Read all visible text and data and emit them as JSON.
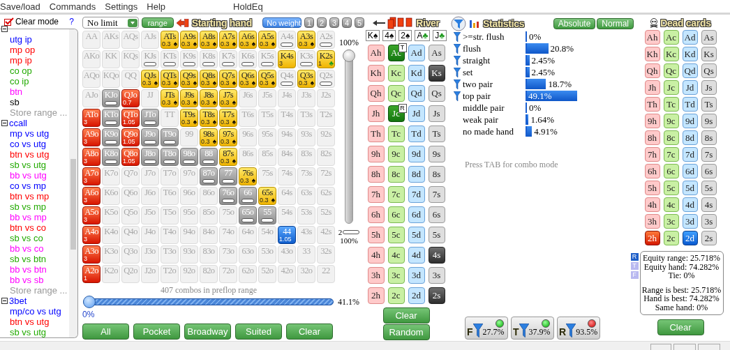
{
  "menu": [
    "Save/load",
    "Commands",
    "Settings",
    "Help"
  ],
  "title": "HoldEq",
  "sidebar": {
    "clear_mode": "Clear mode",
    "help": "?",
    "tree": [
      {
        "expanded": true,
        "children": [
          {
            "label": "utg ip",
            "color": "#0000ff"
          },
          {
            "label": "mp op",
            "color": "#ff0000"
          },
          {
            "label": "mp ip",
            "color": "#ff0000"
          },
          {
            "label": "co op",
            "color": "#22aa00"
          },
          {
            "label": "co ip",
            "color": "#22aa00"
          },
          {
            "label": "btn",
            "color": "#ff00ff"
          },
          {
            "label": "sb",
            "color": "#000000"
          },
          {
            "label": "Store range ...",
            "color": "#999999"
          }
        ]
      },
      {
        "label": "ccall",
        "color": "#0000ff",
        "expanded": true,
        "children": [
          {
            "label": "mp vs utg",
            "color": "#0000ff"
          },
          {
            "label": "co vs utg",
            "color": "#0000ff"
          },
          {
            "label": "btn vs utg",
            "color": "#ff0000"
          },
          {
            "label": "sb vs utg",
            "color": "#22aa00"
          },
          {
            "label": "bb vs utg",
            "color": "#ff00ff"
          },
          {
            "label": "co vs mp",
            "color": "#0000ff"
          },
          {
            "label": "btn vs mp",
            "color": "#ff0000"
          },
          {
            "label": "sb vs mp",
            "color": "#22aa00"
          },
          {
            "label": "bb vs mp",
            "color": "#ff00ff"
          },
          {
            "label": "btn vs co",
            "color": "#ff0000"
          },
          {
            "label": "sb vs co",
            "color": "#22aa00"
          },
          {
            "label": "bb vs co",
            "color": "#ff00ff"
          },
          {
            "label": "sb vs btn",
            "color": "#22aa00"
          },
          {
            "label": "bb vs btn",
            "color": "#ff00ff"
          },
          {
            "label": "bb vs sb",
            "color": "#ff00ff"
          },
          {
            "label": "Store range ...",
            "color": "#999999"
          }
        ]
      },
      {
        "label": "3bet",
        "color": "#0000ff",
        "expanded": true,
        "children": [
          {
            "label": "mp/co vs utg",
            "color": "#0000ff"
          },
          {
            "label": "btn vs utg",
            "color": "#ff0000"
          },
          {
            "label": "sb vs utg",
            "color": "#22aa00"
          }
        ]
      }
    ]
  },
  "range": {
    "game": "No limit",
    "range_button": "range",
    "title": "Starting hand",
    "weights": [
      {
        "label": "No weight",
        "selected": true
      },
      {
        "label": "1",
        "selected": false
      },
      {
        "label": "2",
        "selected": false
      },
      {
        "label": "3",
        "selected": false
      },
      {
        "label": "4",
        "selected": false
      },
      {
        "label": "5",
        "selected": false
      }
    ],
    "grid": [
      [
        {
          "hand": "AA",
          "kind": "empty"
        },
        {
          "hand": "AKs",
          "kind": "empty"
        },
        {
          "hand": "AQs",
          "kind": "empty"
        },
        {
          "hand": "AJs",
          "kind": "empty"
        },
        {
          "hand": "ATs",
          "kind": "yellow",
          "weight": "0.3",
          "suit": "♠",
          "color": "#000000"
        },
        {
          "hand": "A9s",
          "kind": "yellow",
          "weight": "0.3",
          "suit": "♠",
          "color": "#000000"
        },
        {
          "hand": "A8s",
          "kind": "yellow",
          "weight": "0.3",
          "suit": "♠",
          "color": "#000000"
        },
        {
          "hand": "A7s",
          "kind": "yellow",
          "weight": "0.3",
          "suit": "♠",
          "color": "#000000"
        },
        {
          "hand": "A6s",
          "kind": "yellow",
          "weight": "0.3",
          "suit": "♠",
          "color": "#000000"
        },
        {
          "hand": "A5s",
          "kind": "yellow",
          "weight": "0.3",
          "suit": "♠",
          "color": "#000000"
        },
        {
          "hand": "A4s",
          "kind": "bar"
        },
        {
          "hand": "A3s",
          "kind": "yellow",
          "weight": "0.3",
          "suit": "♠",
          "color": "#000000"
        },
        {
          "hand": "A2s",
          "kind": "bar"
        }
      ],
      [
        {
          "hand": "AKo",
          "kind": "empty"
        },
        {
          "hand": "KK",
          "kind": "empty"
        },
        {
          "hand": "KQs",
          "kind": "empty"
        },
        {
          "hand": "KJs",
          "kind": "bar"
        },
        {
          "hand": "KTs",
          "kind": "bar"
        },
        {
          "hand": "K9s",
          "kind": "bar"
        },
        {
          "hand": "K8s",
          "kind": "bar"
        },
        {
          "hand": "K7s",
          "kind": "bar"
        },
        {
          "hand": "K6s",
          "kind": "bar"
        },
        {
          "hand": "K5s",
          "kind": "bar"
        },
        {
          "hand": "K4s",
          "kind": "yellow",
          "weight": "3"
        },
        {
          "hand": "K3s",
          "kind": "bar"
        },
        {
          "hand": "K2s",
          "kind": "yellow",
          "weight": "1",
          "suit": "♣",
          "color": "#1e9a1e"
        }
      ],
      [
        {
          "hand": "AQo",
          "kind": "empty"
        },
        {
          "hand": "KQo",
          "kind": "empty"
        },
        {
          "hand": "QQ",
          "kind": "empty"
        },
        {
          "hand": "QJs",
          "kind": "yellow",
          "weight": "0.3",
          "suit": "♠",
          "color": "#000000"
        },
        {
          "hand": "QTs",
          "kind": "yellow",
          "weight": "0.3",
          "suit": "♠",
          "color": "#000000"
        },
        {
          "hand": "Q9s",
          "kind": "yellow",
          "weight": "0.3",
          "suit": "♠",
          "color": "#000000"
        },
        {
          "hand": "Q8s",
          "kind": "yellow",
          "weight": "0.3",
          "suit": "♠",
          "color": "#000000"
        },
        {
          "hand": "Q7s",
          "kind": "yellow",
          "weight": "0.3",
          "suit": "♠",
          "color": "#000000"
        },
        {
          "hand": "Q6s",
          "kind": "yellow",
          "weight": "0.3",
          "suit": "♠",
          "color": "#000000"
        },
        {
          "hand": "Q5s",
          "kind": "yellow",
          "weight": "0.3",
          "suit": "♠",
          "color": "#000000"
        },
        {
          "hand": "Q4s",
          "kind": "bar"
        },
        {
          "hand": "Q3s",
          "kind": "yellow",
          "weight": "0.3",
          "suit": "♠",
          "color": "#000000"
        },
        {
          "hand": "Q2s",
          "kind": "bar"
        }
      ],
      [
        {
          "hand": "AJo",
          "kind": "empty"
        },
        {
          "hand": "KJo",
          "kind": "dark"
        },
        {
          "hand": "QJo",
          "kind": "red",
          "weight": "0.7"
        },
        {
          "hand": "JJ",
          "kind": "empty"
        },
        {
          "hand": "JTs",
          "kind": "yellow",
          "weight": "0.3",
          "suit": "♠",
          "color": "#000000"
        },
        {
          "hand": "J9s",
          "kind": "yellow",
          "weight": "0.3",
          "suit": "♠",
          "color": "#000000"
        },
        {
          "hand": "J8s",
          "kind": "yellow",
          "weight": "0.3",
          "suit": "♠",
          "color": "#000000"
        },
        {
          "hand": "J7s",
          "kind": "yellow",
          "weight": "0.3",
          "suit": "♠",
          "color": "#000000"
        },
        {
          "hand": "J6s",
          "kind": "empty"
        },
        {
          "hand": "J5s",
          "kind": "empty"
        },
        {
          "hand": "J4s",
          "kind": "empty"
        },
        {
          "hand": "J3s",
          "kind": "empty"
        },
        {
          "hand": "J2s",
          "kind": "empty"
        }
      ],
      [
        {
          "hand": "ATo",
          "kind": "red",
          "weight": "3"
        },
        {
          "hand": "KTo",
          "kind": "dark"
        },
        {
          "hand": "QTo",
          "kind": "red",
          "weight": "1.05"
        },
        {
          "hand": "JTo",
          "kind": "dark"
        },
        {
          "hand": "TT",
          "kind": "empty"
        },
        {
          "hand": "T9s",
          "kind": "yellow",
          "weight": "0.3",
          "suit": "♠",
          "color": "#000000"
        },
        {
          "hand": "T8s",
          "kind": "yellow",
          "weight": "0.3",
          "suit": "♠",
          "color": "#000000"
        },
        {
          "hand": "T7s",
          "kind": "yellow",
          "weight": "0.3",
          "suit": "♠",
          "color": "#000000"
        },
        {
          "hand": "T6s",
          "kind": "empty"
        },
        {
          "hand": "T5s",
          "kind": "empty"
        },
        {
          "hand": "T4s",
          "kind": "empty"
        },
        {
          "hand": "T3s",
          "kind": "empty"
        },
        {
          "hand": "T2s",
          "kind": "empty"
        }
      ],
      [
        {
          "hand": "A9o",
          "kind": "red",
          "weight": "3"
        },
        {
          "hand": "K9o",
          "kind": "dark"
        },
        {
          "hand": "Q9o",
          "kind": "red",
          "weight": "1.05"
        },
        {
          "hand": "J9o",
          "kind": "dark"
        },
        {
          "hand": "T9o",
          "kind": "dark"
        },
        {
          "hand": "99",
          "kind": "empty"
        },
        {
          "hand": "98s",
          "kind": "yellow",
          "weight": "0.3",
          "suit": "♠",
          "color": "#000000"
        },
        {
          "hand": "97s",
          "kind": "yellow",
          "weight": "0.3",
          "suit": "♠",
          "color": "#000000"
        },
        {
          "hand": "96s",
          "kind": "empty"
        },
        {
          "hand": "95s",
          "kind": "empty"
        },
        {
          "hand": "94s",
          "kind": "empty"
        },
        {
          "hand": "93s",
          "kind": "empty"
        },
        {
          "hand": "92s",
          "kind": "empty"
        }
      ],
      [
        {
          "hand": "A8o",
          "kind": "red",
          "weight": "3"
        },
        {
          "hand": "K8o",
          "kind": "dark"
        },
        {
          "hand": "Q8o",
          "kind": "red",
          "weight": "1.05"
        },
        {
          "hand": "J8o",
          "kind": "dark"
        },
        {
          "hand": "T8o",
          "kind": "dark"
        },
        {
          "hand": "98o",
          "kind": "dark"
        },
        {
          "hand": "88",
          "kind": "dark"
        },
        {
          "hand": "87s",
          "kind": "yellow",
          "weight": "0.3",
          "suit": "♠",
          "color": "#000000"
        },
        {
          "hand": "86s",
          "kind": "empty"
        },
        {
          "hand": "85s",
          "kind": "empty"
        },
        {
          "hand": "84s",
          "kind": "empty"
        },
        {
          "hand": "83s",
          "kind": "empty"
        },
        {
          "hand": "82s",
          "kind": "empty"
        }
      ],
      [
        {
          "hand": "A7o",
          "kind": "red",
          "weight": "3"
        },
        {
          "hand": "K7o",
          "kind": "empty"
        },
        {
          "hand": "Q7o",
          "kind": "empty"
        },
        {
          "hand": "J7o",
          "kind": "empty"
        },
        {
          "hand": "T7o",
          "kind": "empty"
        },
        {
          "hand": "97o",
          "kind": "empty"
        },
        {
          "hand": "87o",
          "kind": "dark"
        },
        {
          "hand": "77",
          "kind": "dark"
        },
        {
          "hand": "76s",
          "kind": "yellow",
          "weight": "0.3",
          "suit": "♠",
          "color": "#000000"
        },
        {
          "hand": "75s",
          "kind": "empty"
        },
        {
          "hand": "74s",
          "kind": "empty"
        },
        {
          "hand": "73s",
          "kind": "empty"
        },
        {
          "hand": "72s",
          "kind": "empty"
        }
      ],
      [
        {
          "hand": "A6o",
          "kind": "red",
          "weight": "3"
        },
        {
          "hand": "K6o",
          "kind": "empty"
        },
        {
          "hand": "Q6o",
          "kind": "empty"
        },
        {
          "hand": "J6o",
          "kind": "empty"
        },
        {
          "hand": "T6o",
          "kind": "empty"
        },
        {
          "hand": "96o",
          "kind": "empty"
        },
        {
          "hand": "86o",
          "kind": "empty"
        },
        {
          "hand": "76o",
          "kind": "dark"
        },
        {
          "hand": "66",
          "kind": "dark"
        },
        {
          "hand": "65s",
          "kind": "yellow",
          "weight": "0.3",
          "suit": "♠",
          "color": "#000000"
        },
        {
          "hand": "64s",
          "kind": "empty"
        },
        {
          "hand": "63s",
          "kind": "empty"
        },
        {
          "hand": "62s",
          "kind": "empty"
        }
      ],
      [
        {
          "hand": "A5o",
          "kind": "red",
          "weight": "3"
        },
        {
          "hand": "K5o",
          "kind": "empty"
        },
        {
          "hand": "Q5o",
          "kind": "empty"
        },
        {
          "hand": "J5o",
          "kind": "empty"
        },
        {
          "hand": "T5o",
          "kind": "empty"
        },
        {
          "hand": "95o",
          "kind": "empty"
        },
        {
          "hand": "85o",
          "kind": "empty"
        },
        {
          "hand": "75o",
          "kind": "empty"
        },
        {
          "hand": "65o",
          "kind": "dark"
        },
        {
          "hand": "55",
          "kind": "dark"
        },
        {
          "hand": "54s",
          "kind": "empty"
        },
        {
          "hand": "53s",
          "kind": "empty"
        },
        {
          "hand": "52s",
          "kind": "empty"
        }
      ],
      [
        {
          "hand": "A4o",
          "kind": "red",
          "weight": "3"
        },
        {
          "hand": "K4o",
          "kind": "empty"
        },
        {
          "hand": "Q4o",
          "kind": "empty"
        },
        {
          "hand": "J4o",
          "kind": "empty"
        },
        {
          "hand": "T4o",
          "kind": "empty"
        },
        {
          "hand": "94o",
          "kind": "empty"
        },
        {
          "hand": "84o",
          "kind": "empty"
        },
        {
          "hand": "74o",
          "kind": "empty"
        },
        {
          "hand": "64o",
          "kind": "empty"
        },
        {
          "hand": "54o",
          "kind": "empty"
        },
        {
          "hand": "44",
          "kind": "blue",
          "weight": "1.05"
        },
        {
          "hand": "43s",
          "kind": "empty"
        },
        {
          "hand": "42s",
          "kind": "empty"
        }
      ],
      [
        {
          "hand": "A3o",
          "kind": "red",
          "weight": "3"
        },
        {
          "hand": "K3o",
          "kind": "empty"
        },
        {
          "hand": "Q3o",
          "kind": "empty"
        },
        {
          "hand": "J3o",
          "kind": "empty"
        },
        {
          "hand": "T3o",
          "kind": "empty"
        },
        {
          "hand": "93o",
          "kind": "empty"
        },
        {
          "hand": "83o",
          "kind": "empty"
        },
        {
          "hand": "73o",
          "kind": "empty"
        },
        {
          "hand": "63o",
          "kind": "empty"
        },
        {
          "hand": "53o",
          "kind": "empty"
        },
        {
          "hand": "43o",
          "kind": "empty"
        },
        {
          "hand": "33",
          "kind": "empty"
        },
        {
          "hand": "32s",
          "kind": "empty"
        }
      ],
      [
        {
          "hand": "A2o",
          "kind": "red",
          "weight": "1"
        },
        {
          "hand": "K2o",
          "kind": "empty"
        },
        {
          "hand": "Q2o",
          "kind": "empty"
        },
        {
          "hand": "J2o",
          "kind": "empty"
        },
        {
          "hand": "T2o",
          "kind": "empty"
        },
        {
          "hand": "92o",
          "kind": "empty"
        },
        {
          "hand": "82o",
          "kind": "empty"
        },
        {
          "hand": "72o",
          "kind": "empty"
        },
        {
          "hand": "62o",
          "kind": "empty"
        },
        {
          "hand": "52o",
          "kind": "empty"
        },
        {
          "hand": "42o",
          "kind": "empty"
        },
        {
          "hand": "32o",
          "kind": "empty"
        },
        {
          "hand": "22",
          "kind": "empty"
        }
      ]
    ],
    "weight_slider": {
      "top_label": "100%",
      "level": 1,
      "bottom_value": "2",
      "bottom_label": "100%"
    },
    "combos": "407 combos in preflop range",
    "preflop_slider": {
      "level": 0,
      "min_label": "0%",
      "value": "41.1%"
    },
    "buttons": [
      "All",
      "Pocket",
      "Broadway",
      "Suited",
      "Clear"
    ]
  },
  "river": {
    "title": "River",
    "board": [
      {
        "rank": "K",
        "suit": "♠",
        "color": "#000000"
      },
      {
        "rank": "4",
        "suit": "♠",
        "color": "#000000"
      },
      {
        "rank": "2",
        "suit": "♠",
        "color": "#000000"
      },
      {
        "rank": "A",
        "suit": "♣",
        "color": "#1e9a1e"
      },
      {
        "rank": "J",
        "suit": "♣",
        "color": "#1e9a1e"
      }
    ],
    "cards": [
      [
        {
          "card": "Ah",
          "selected": false
        },
        {
          "card": "Ac",
          "selected": true,
          "badge": "T"
        },
        {
          "card": "Ad",
          "selected": false
        },
        {
          "card": "As",
          "selected": false
        }
      ],
      [
        {
          "card": "Kh",
          "selected": false
        },
        {
          "card": "Kc",
          "selected": false
        },
        {
          "card": "Kd",
          "selected": false
        },
        {
          "card": "Ks",
          "selected": true
        }
      ],
      [
        {
          "card": "Qh",
          "selected": false
        },
        {
          "card": "Qc",
          "selected": false
        },
        {
          "card": "Qd",
          "selected": false
        },
        {
          "card": "Qs",
          "selected": false
        }
      ],
      [
        {
          "card": "Jh",
          "selected": false
        },
        {
          "card": "Jc",
          "selected": true,
          "badge": "R"
        },
        {
          "card": "Jd",
          "selected": false
        },
        {
          "card": "Js",
          "selected": false
        }
      ],
      [
        {
          "card": "Th",
          "selected": false
        },
        {
          "card": "Tc",
          "selected": false
        },
        {
          "card": "Td",
          "selected": false
        },
        {
          "card": "Ts",
          "selected": false
        }
      ],
      [
        {
          "card": "9h",
          "selected": false
        },
        {
          "card": "9c",
          "selected": false
        },
        {
          "card": "9d",
          "selected": false
        },
        {
          "card": "9s",
          "selected": false
        }
      ],
      [
        {
          "card": "8h",
          "selected": false
        },
        {
          "card": "8c",
          "selected": false
        },
        {
          "card": "8d",
          "selected": false
        },
        {
          "card": "8s",
          "selected": false
        }
      ],
      [
        {
          "card": "7h",
          "selected": false
        },
        {
          "card": "7c",
          "selected": false
        },
        {
          "card": "7d",
          "selected": false
        },
        {
          "card": "7s",
          "selected": false
        }
      ],
      [
        {
          "card": "6h",
          "selected": false
        },
        {
          "card": "6c",
          "selected": false
        },
        {
          "card": "6d",
          "selected": false
        },
        {
          "card": "6s",
          "selected": false
        }
      ],
      [
        {
          "card": "5h",
          "selected": false
        },
        {
          "card": "5c",
          "selected": false
        },
        {
          "card": "5d",
          "selected": false
        },
        {
          "card": "5s",
          "selected": false
        }
      ],
      [
        {
          "card": "4h",
          "selected": false
        },
        {
          "card": "4c",
          "selected": false
        },
        {
          "card": "4d",
          "selected": false
        },
        {
          "card": "4s",
          "selected": true
        }
      ],
      [
        {
          "card": "3h",
          "selected": false
        },
        {
          "card": "3c",
          "selected": false
        },
        {
          "card": "3d",
          "selected": false
        },
        {
          "card": "3s",
          "selected": false
        }
      ],
      [
        {
          "card": "2h",
          "selected": false
        },
        {
          "card": "2c",
          "selected": false
        },
        {
          "card": "2d",
          "selected": false
        },
        {
          "card": "2s",
          "selected": true
        }
      ]
    ],
    "buttons": [
      "Clear",
      "Random"
    ]
  },
  "statistics": {
    "title": "Statistics",
    "modes": [
      "Absolute",
      "Normal"
    ],
    "rows": [
      {
        "label": ">=str. flush",
        "filter": true,
        "value": "0%"
      },
      {
        "label": "flush",
        "filter": true,
        "level": 0.208,
        "value": "20.8%"
      },
      {
        "label": "straight",
        "filter": true,
        "level": 0.0245,
        "value": "2.45%"
      },
      {
        "label": "set",
        "filter": true,
        "level": 0.0245,
        "value": "2.45%"
      },
      {
        "label": "two pair",
        "filter": true,
        "level": 0.187,
        "value": "18.7%"
      },
      {
        "label": "top pair",
        "filter": true,
        "level": 0.491,
        "value": "49.1%"
      },
      {
        "label": "middle pair",
        "filter": false,
        "value": "0%"
      },
      {
        "label": "weak pair",
        "filter": false,
        "level": 0.0164,
        "value": "1.64%"
      },
      {
        "label": "no made hand",
        "filter": false,
        "level": 0.0491,
        "value": "4.91%"
      }
    ],
    "note": "Press TAB for combo mode",
    "filters": [
      {
        "label": "F",
        "value": "27.7%",
        "on": true
      },
      {
        "label": "T",
        "value": "37.9%",
        "on": true
      },
      {
        "label": "R",
        "value": "93.5%",
        "on": false
      }
    ]
  },
  "dead_cards": {
    "title": "Dead cards",
    "cards": [
      [
        {
          "card": "Ah",
          "selected": false
        },
        {
          "card": "Ac",
          "selected": false
        },
        {
          "card": "Ad",
          "selected": false
        },
        {
          "card": "As",
          "selected": false
        }
      ],
      [
        {
          "card": "Kh",
          "selected": false
        },
        {
          "card": "Kc",
          "selected": false
        },
        {
          "card": "Kd",
          "selected": false
        },
        {
          "card": "Ks",
          "selected": false
        }
      ],
      [
        {
          "card": "Qh",
          "selected": false
        },
        {
          "card": "Qc",
          "selected": false
        },
        {
          "card": "Qd",
          "selected": false
        },
        {
          "card": "Qs",
          "selected": false
        }
      ],
      [
        {
          "card": "Jh",
          "selected": false
        },
        {
          "card": "Jc",
          "selected": false
        },
        {
          "card": "Jd",
          "selected": false
        },
        {
          "card": "Js",
          "selected": false
        }
      ],
      [
        {
          "card": "Th",
          "selected": false
        },
        {
          "card": "Tc",
          "selected": false
        },
        {
          "card": "Td",
          "selected": false
        },
        {
          "card": "Ts",
          "selected": false
        }
      ],
      [
        {
          "card": "9h",
          "selected": false
        },
        {
          "card": "9c",
          "selected": false
        },
        {
          "card": "9d",
          "selected": false
        },
        {
          "card": "9s",
          "selected": false
        }
      ],
      [
        {
          "card": "8h",
          "selected": false
        },
        {
          "card": "8c",
          "selected": false
        },
        {
          "card": "8d",
          "selected": false
        },
        {
          "card": "8s",
          "selected": false
        }
      ],
      [
        {
          "card": "7h",
          "selected": false
        },
        {
          "card": "7c",
          "selected": false
        },
        {
          "card": "7d",
          "selected": false
        },
        {
          "card": "7s",
          "selected": false
        }
      ],
      [
        {
          "card": "6h",
          "selected": false
        },
        {
          "card": "6c",
          "selected": false
        },
        {
          "card": "6d",
          "selected": false
        },
        {
          "card": "6s",
          "selected": false
        }
      ],
      [
        {
          "card": "5h",
          "selected": false
        },
        {
          "card": "5c",
          "selected": false
        },
        {
          "card": "5d",
          "selected": false
        },
        {
          "card": "5s",
          "selected": false
        }
      ],
      [
        {
          "card": "4h",
          "selected": false
        },
        {
          "card": "4c",
          "selected": false
        },
        {
          "card": "4d",
          "selected": false
        },
        {
          "card": "4s",
          "selected": false
        }
      ],
      [
        {
          "card": "3h",
          "selected": false
        },
        {
          "card": "3c",
          "selected": false
        },
        {
          "card": "3d",
          "selected": false
        },
        {
          "card": "3s",
          "selected": false
        }
      ],
      [
        {
          "card": "2h",
          "selected": true
        },
        {
          "card": "2c",
          "selected": false
        },
        {
          "card": "2d",
          "selected": true
        },
        {
          "card": "2s",
          "selected": false
        }
      ]
    ],
    "equity_modes": [
      {
        "label": "R",
        "selected": true
      },
      {
        "label": "T",
        "selected": false
      },
      {
        "label": "F",
        "selected": false
      }
    ],
    "equity": [
      [
        "Equity range: 25.718%",
        "Equity hand: 74.282%",
        "Tie: 0%"
      ],
      [
        "Range is best: 25.718%",
        "Hand is best: 74.282%",
        "Same hand: 0%"
      ]
    ],
    "button": "Clear"
  }
}
